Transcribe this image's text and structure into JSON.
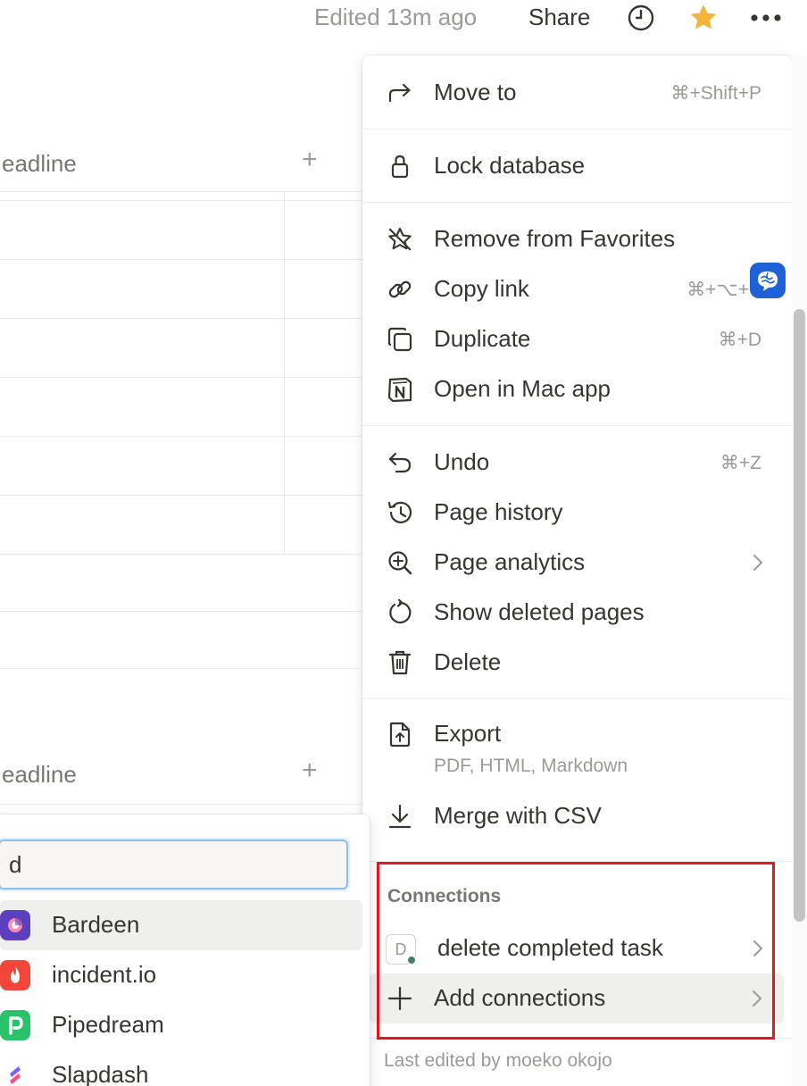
{
  "topbar": {
    "edited": "Edited 13m ago",
    "share": "Share",
    "icons": [
      "clock-icon",
      "star-icon",
      "more-icon"
    ],
    "star_color": "#f5b43a"
  },
  "background": {
    "header_1": "eadline",
    "header_2": "eadline"
  },
  "menu": {
    "group1": [
      {
        "label": "Move to",
        "shortcut": "⌘+Shift+P",
        "icon": "arrow-turn-icon"
      }
    ],
    "group2": [
      {
        "label": "Lock database",
        "icon": "lock-icon"
      }
    ],
    "group3": [
      {
        "label": "Remove from Favorites",
        "icon": "star-outline-icon"
      },
      {
        "label": "Copy link",
        "shortcut": "⌘+⌥+",
        "icon": "link-icon"
      },
      {
        "label": "Duplicate",
        "shortcut": "⌘+D",
        "icon": "duplicate-icon"
      },
      {
        "label": "Open in Mac app",
        "icon": "notion-icon"
      }
    ],
    "group4": [
      {
        "label": "Undo",
        "shortcut": "⌘+Z",
        "icon": "undo-icon"
      },
      {
        "label": "Page history",
        "icon": "history-icon"
      },
      {
        "label": "Page analytics",
        "icon": "analytics-icon"
      },
      {
        "label": "Show deleted pages",
        "icon": "restore-icon"
      },
      {
        "label": "Delete",
        "icon": "trash-icon"
      }
    ],
    "group5": [
      {
        "label": "Export",
        "sublabel": "PDF, HTML, Markdown",
        "icon": "export-icon"
      },
      {
        "label": "Merge with CSV",
        "icon": "download-icon"
      }
    ],
    "connections": {
      "section_label": "Connections",
      "item": {
        "label": "delete completed task",
        "badge": "D"
      },
      "add": "Add connections"
    },
    "footer": "Last edited by moeko okojo"
  },
  "popup": {
    "search_value": "d",
    "items": [
      {
        "label": "Bardeen",
        "icon": "bardeen-icon",
        "color": "#5b3fbf"
      },
      {
        "label": "incident.io",
        "icon": "incident-icon",
        "color": "#f2463b"
      },
      {
        "label": "Pipedream",
        "icon": "pipedream-icon",
        "color": "#27c26a"
      },
      {
        "label": "Slapdash",
        "icon": "slapdash-icon",
        "color": "#7b61ff"
      }
    ]
  }
}
